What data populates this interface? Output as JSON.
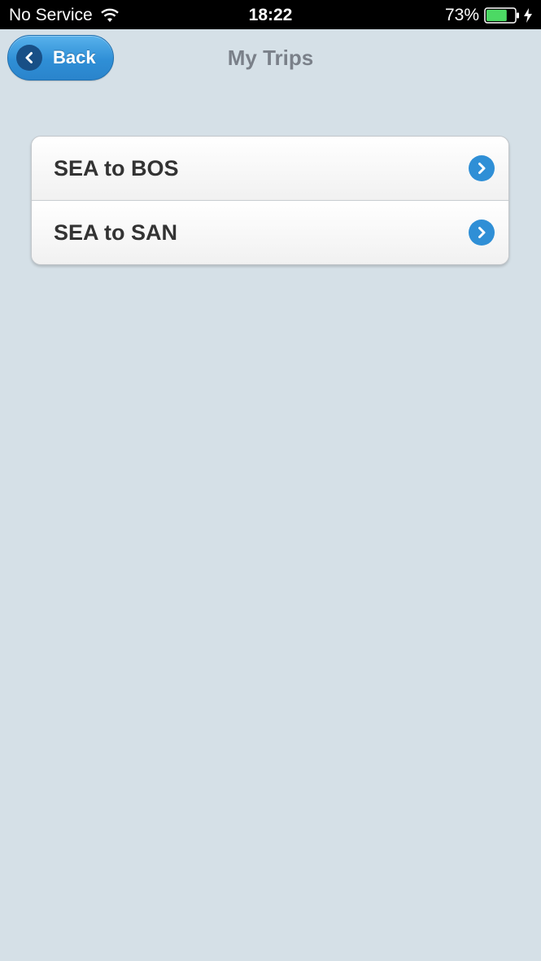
{
  "status_bar": {
    "carrier": "No Service",
    "time": "18:22",
    "battery_percent": "73%",
    "battery_level": 0.73,
    "icons": [
      "wifi-icon",
      "battery-icon",
      "charging-bolt-icon"
    ]
  },
  "nav": {
    "back_label": "Back",
    "title": "My Trips",
    "back_icon": "chevron-left-icon"
  },
  "trips": [
    {
      "label": "SEA to BOS",
      "icon": "chevron-right-icon"
    },
    {
      "label": "SEA to SAN",
      "icon": "chevron-right-icon"
    }
  ],
  "colors": {
    "background": "#d5e0e7",
    "accent": "#2f8fd6",
    "title": "#7a8089",
    "battery": "#4cd964"
  }
}
